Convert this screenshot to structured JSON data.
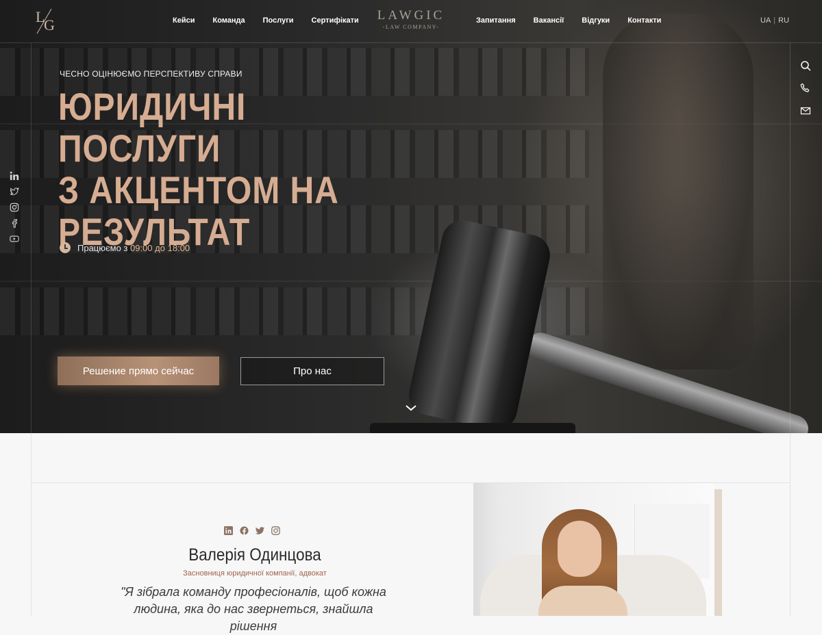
{
  "header": {
    "logo_letters": [
      "L",
      "G"
    ],
    "brand_name": "LAWGIC",
    "brand_sub": "-LAW COMPANY-",
    "nav_left": [
      {
        "label": "Кейси"
      },
      {
        "label": "Команда"
      },
      {
        "label": "Послуги"
      },
      {
        "label": "Сертифікати"
      }
    ],
    "nav_right": [
      {
        "label": "Запитання"
      },
      {
        "label": "Вакансії"
      },
      {
        "label": "Відгуки"
      },
      {
        "label": "Контакти"
      }
    ],
    "lang": {
      "ua": "UA",
      "separator": "|",
      "ru": "RU"
    }
  },
  "hero": {
    "kicker": "ЧЕСНО ОЦІНЮЄМО ПЕРСПЕКТИВУ СПРАВИ",
    "headline_lines": [
      "ЮРИДИЧНІ ПОСЛУГИ",
      "З АКЦЕНТОМ НА",
      "РЕЗУЛЬТАТ"
    ],
    "hours_prefix": "Працюємо з",
    "hours_from": "09:00",
    "hours_mid": "до",
    "hours_to": "18:00",
    "primary_button": "Решение прямо сейчас",
    "secondary_button": "Про нас",
    "accent_color": "#d6ad92"
  },
  "social_left": [
    "linkedin-icon",
    "twitter-icon",
    "instagram-icon",
    "facebook-icon",
    "youtube-icon"
  ],
  "tools_right": [
    "search-icon",
    "phone-icon",
    "mail-icon"
  ],
  "founder": {
    "social": [
      "linkedin-icon",
      "facebook-icon",
      "twitter-icon",
      "instagram-icon"
    ],
    "name": "Валерія Одинцова",
    "role": "Засновниця юридичної компанії, адвокат",
    "quote_line1": "\"Я зібрала команду професіоналів, щоб кожна",
    "quote_line2": "людина, яка до нас звернеться, знайшла рішення"
  }
}
